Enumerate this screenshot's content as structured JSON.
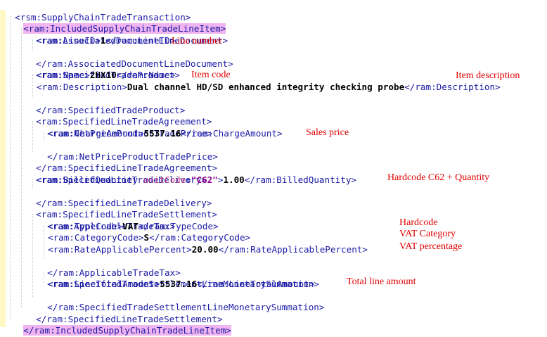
{
  "xml": {
    "l1": {
      "tag": "<rsm:SupplyChainTradeTransaction>"
    },
    "l2": {
      "tag": "<ram:IncludedSupplyChainTradeLineItem>"
    },
    "l3": {
      "tag": "<ram:AssociatedDocumentLineDocument>"
    },
    "l4": {
      "open": "<ram:LineID>",
      "value": "1",
      "close": "</ram:LineID>"
    },
    "l5": {
      "tag": "</ram:AssociatedDocumentLineDocument>"
    },
    "l6": {
      "tag": "<ram:SpecifiedTradeProduct>"
    },
    "l7": {
      "open": "<ram:Name>",
      "value": "2HX10",
      "close": "</ram:Name>"
    },
    "l8": {
      "open": "<ram:Description>",
      "value": "Dual channel HD/SD enhanced integrity checking probe",
      "close": "</ram:Description>"
    },
    "l9": {
      "tag": "</ram:SpecifiedTradeProduct>"
    },
    "l10": {
      "tag": "<ram:SpecifiedLineTradeAgreement>"
    },
    "l11": {
      "tag": "<ram:NetPriceProductTradePrice>"
    },
    "l12": {
      "open": "<ram:ChargeAmount>",
      "value": "5537.16",
      "close": "</ram:ChargeAmount>"
    },
    "l13": {
      "tag": "</ram:NetPriceProductTradePrice>"
    },
    "l14": {
      "tag": "</ram:SpecifiedLineTradeAgreement>"
    },
    "l15": {
      "tag": "<ram:SpecifiedLineTradeDelivery>"
    },
    "l16": {
      "open": "<ram:BilledQuantity ",
      "attr": "unitCode",
      "eq": "=",
      "attrval": "\"C62\"",
      "gt": ">",
      "value": "1.00",
      "close": "</ram:BilledQuantity>"
    },
    "l17": {
      "tag": "</ram:SpecifiedLineTradeDelivery>"
    },
    "l18": {
      "tag": "<ram:SpecifiedLineTradeSettlement>"
    },
    "l19": {
      "tag": "<ram:ApplicableTradeTax>"
    },
    "l20": {
      "open": "<ram:TypeCode>",
      "value": "VAT",
      "close": "</ram:TypeCode>"
    },
    "l21": {
      "open": "<ram:CategoryCode>",
      "value": "S",
      "close": "</ram:CategoryCode>"
    },
    "l22": {
      "open": "<ram:RateApplicablePercent>",
      "value": "20.00",
      "close": "</ram:RateApplicablePercent>"
    },
    "l23": {
      "tag": "</ram:ApplicableTradeTax>"
    },
    "l24": {
      "tag": "<ram:SpecifiedTradeSettlementLineMonetarySummation>"
    },
    "l25": {
      "open": "<ram:LineTotalAmount>",
      "value": "5537.16",
      "close": "</ram:LineTotalAmount>"
    },
    "l26": {
      "tag": "</ram:SpecifiedTradeSettlementLineMonetarySummation>"
    },
    "l27": {
      "tag": "</ram:SpecifiedLineTradeSettlement>"
    },
    "l28": {
      "tag": "</ram:IncludedSupplyChainTradeLineItem>"
    }
  },
  "annotations": {
    "line_number": "Line number",
    "item_code": "Item code",
    "item_description": "Item description",
    "sales_price": "Sales price",
    "quantity": "Hardcode C62 + Quantity",
    "hardcode": "Hardcode",
    "vat_category": "VAT Category",
    "vat_percentage": "VAT percentage",
    "total_line_amount": "Total line amount"
  },
  "colors": {
    "tag": "#1a1aa6",
    "attribute": "#c0408a",
    "attribute_value": "#8b008b",
    "annotation": "#e00000",
    "highlight": "#f0b4f0",
    "gutter": "#fff8c4"
  }
}
